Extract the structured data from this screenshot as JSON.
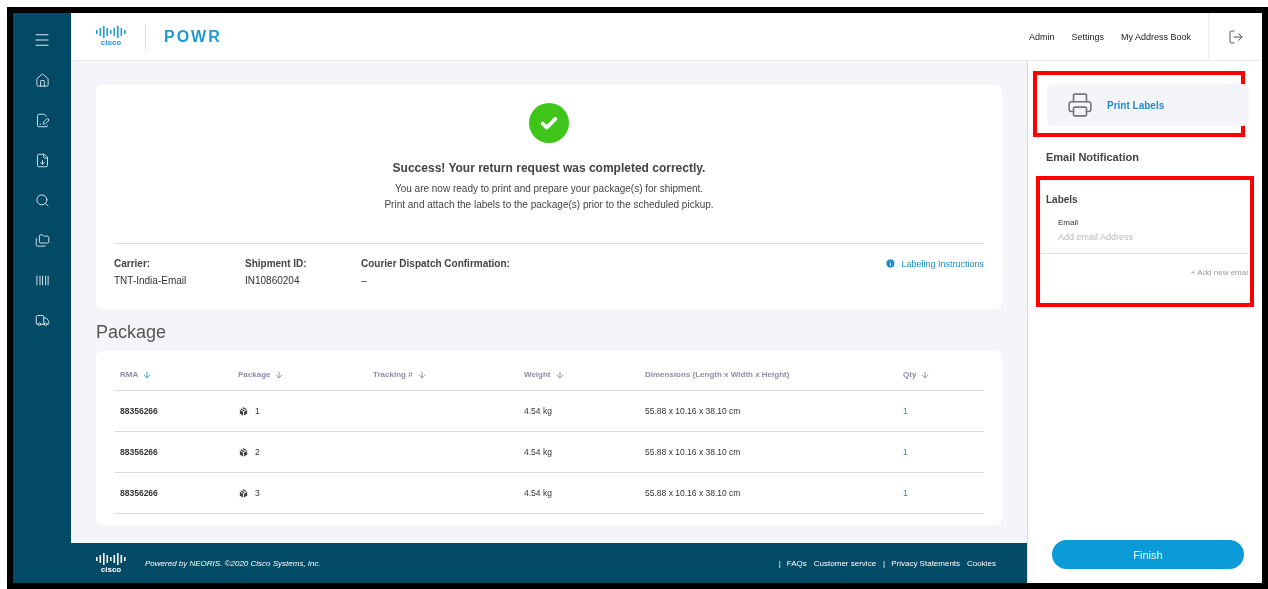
{
  "header": {
    "brand": "cisco",
    "logo": "POWR",
    "nav": [
      "Admin",
      "Settings",
      "My Address Book"
    ]
  },
  "success": {
    "title": "Success! Your return request was completed correctly.",
    "lines": [
      "You are now ready to print and prepare your package(s) for shipment.",
      "Print and attach the labels to the package(s) prior to the scheduled pickup."
    ],
    "details": [
      {
        "label": "Carrier:",
        "value": "TNT-India-Email"
      },
      {
        "label": "Shipment ID:",
        "value": "IN10860204"
      },
      {
        "label": "Courier Dispatch Confirmation:",
        "value": "–"
      }
    ],
    "link": "Labeling Instructions"
  },
  "package": {
    "title": "Package",
    "columns": [
      {
        "label": "RMA",
        "kind": "sortable",
        "selected": true
      },
      {
        "label": "Package",
        "kind": "sortable",
        "selected": false
      },
      {
        "label": "Tracking #",
        "kind": "sortable",
        "selected": false
      },
      {
        "label": "Weight",
        "kind": "sortable",
        "selected": false
      },
      {
        "label": "Dimensions (Length x Width x Height)",
        "kind": "plain",
        "selected": false
      },
      {
        "label": "Qty",
        "kind": "sortable",
        "selected": false
      }
    ],
    "rows": [
      {
        "rma": "88356266",
        "package": "1",
        "weight": "4.54 kg",
        "dimensions": "55.88 x 10.16 x 38.10 cm",
        "qty": "1"
      },
      {
        "rma": "88356266",
        "package": "2",
        "weight": "4.54 kg",
        "dimensions": "55.88 x 10.16 x 38.10 cm",
        "qty": "1"
      },
      {
        "rma": "88356266",
        "package": "3",
        "weight": "4.54 kg",
        "dimensions": "55.88 x 10.16 x 38.10 cm",
        "qty": "1"
      }
    ]
  },
  "footer": {
    "logo": "cisco",
    "text": "Powered by NEORIS. ©2020 Cisco Systems, Inc.",
    "links": [
      {
        "label": "FAQs",
        "separator": "|"
      },
      {
        "label": "Customer service"
      },
      {
        "label": "Privacy Statements",
        "separator": "|"
      },
      {
        "label": "Cookies"
      }
    ]
  },
  "panel": {
    "print": {
      "label": "Print Labels",
      "highlighted": true
    },
    "heading": "Email Notification",
    "labels": {
      "title": "Labels",
      "highlighted": true,
      "field_label": "Email",
      "placeholder": "Add email Address",
      "add": "+ Add new emai"
    },
    "finish": "Finish"
  }
}
